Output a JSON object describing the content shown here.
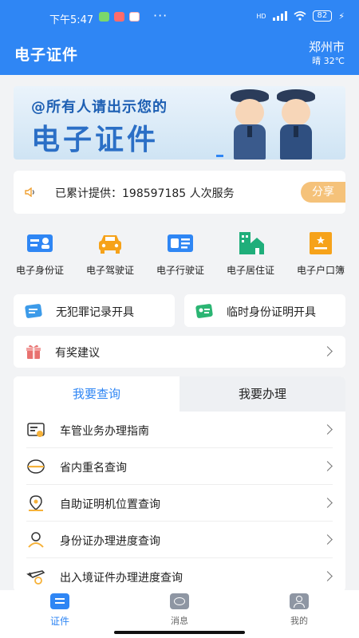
{
  "status_bar": {
    "time": "下午5:47",
    "dots": "···",
    "network": "HD",
    "battery": "82",
    "icons": [
      "wechat-icon",
      "app-icon",
      "weibo-icon",
      "signal-icon",
      "wifi-icon",
      "battery-icon",
      "charging-icon"
    ]
  },
  "header": {
    "title": "电子证件",
    "city": "郑州市",
    "weather": "晴 32℃"
  },
  "banner": {
    "line1": "@所有人请出示您的",
    "line2": "电子证件"
  },
  "info": {
    "text": "已累计提供：198597185 人次服务",
    "share_label": "分享"
  },
  "documents": [
    {
      "label": "电子身份证",
      "icon": "id-card-icon",
      "color": "#2f86f4"
    },
    {
      "label": "电子驾驶证",
      "icon": "car-icon",
      "color": "#f6a21a"
    },
    {
      "label": "电子行驶证",
      "icon": "vehicle-license-icon",
      "color": "#2f86f4"
    },
    {
      "label": "电子居住证",
      "icon": "residence-icon",
      "color": "#1fae7a"
    },
    {
      "label": "电子户口簿",
      "icon": "household-book-icon",
      "color": "#f6a21a"
    }
  ],
  "quick_cards": [
    {
      "label": "无犯罪记录开具",
      "icon": "record-icon",
      "color": "#3d9be9"
    },
    {
      "label": "临时身份证明开具",
      "icon": "temp-id-icon",
      "color": "#2bb573"
    }
  ],
  "suggestion": {
    "label": "有奖建议",
    "icon": "gift-icon"
  },
  "tabs": [
    {
      "label": "我要查询",
      "active": true
    },
    {
      "label": "我要办理",
      "active": false
    }
  ],
  "query_list": [
    {
      "label": "车管业务办理指南",
      "icon": "guide-icon"
    },
    {
      "label": "省内重名查询",
      "icon": "duplicate-name-icon"
    },
    {
      "label": "自助证明机位置查询",
      "icon": "location-icon"
    },
    {
      "label": "身份证办理进度查询",
      "icon": "person-icon"
    },
    {
      "label": "出入境证件办理进度查询",
      "icon": "plane-icon"
    }
  ],
  "bottom_nav": [
    {
      "label": "证件",
      "icon": "card-nav-icon",
      "active": true
    },
    {
      "label": "消息",
      "icon": "message-nav-icon",
      "active": false
    },
    {
      "label": "我的",
      "icon": "profile-nav-icon",
      "active": false
    }
  ],
  "colors": {
    "primary": "#2f86f4",
    "accent_orange": "#f6a21a",
    "accent_green": "#1fae7a",
    "share_button": "#f5c27a"
  }
}
